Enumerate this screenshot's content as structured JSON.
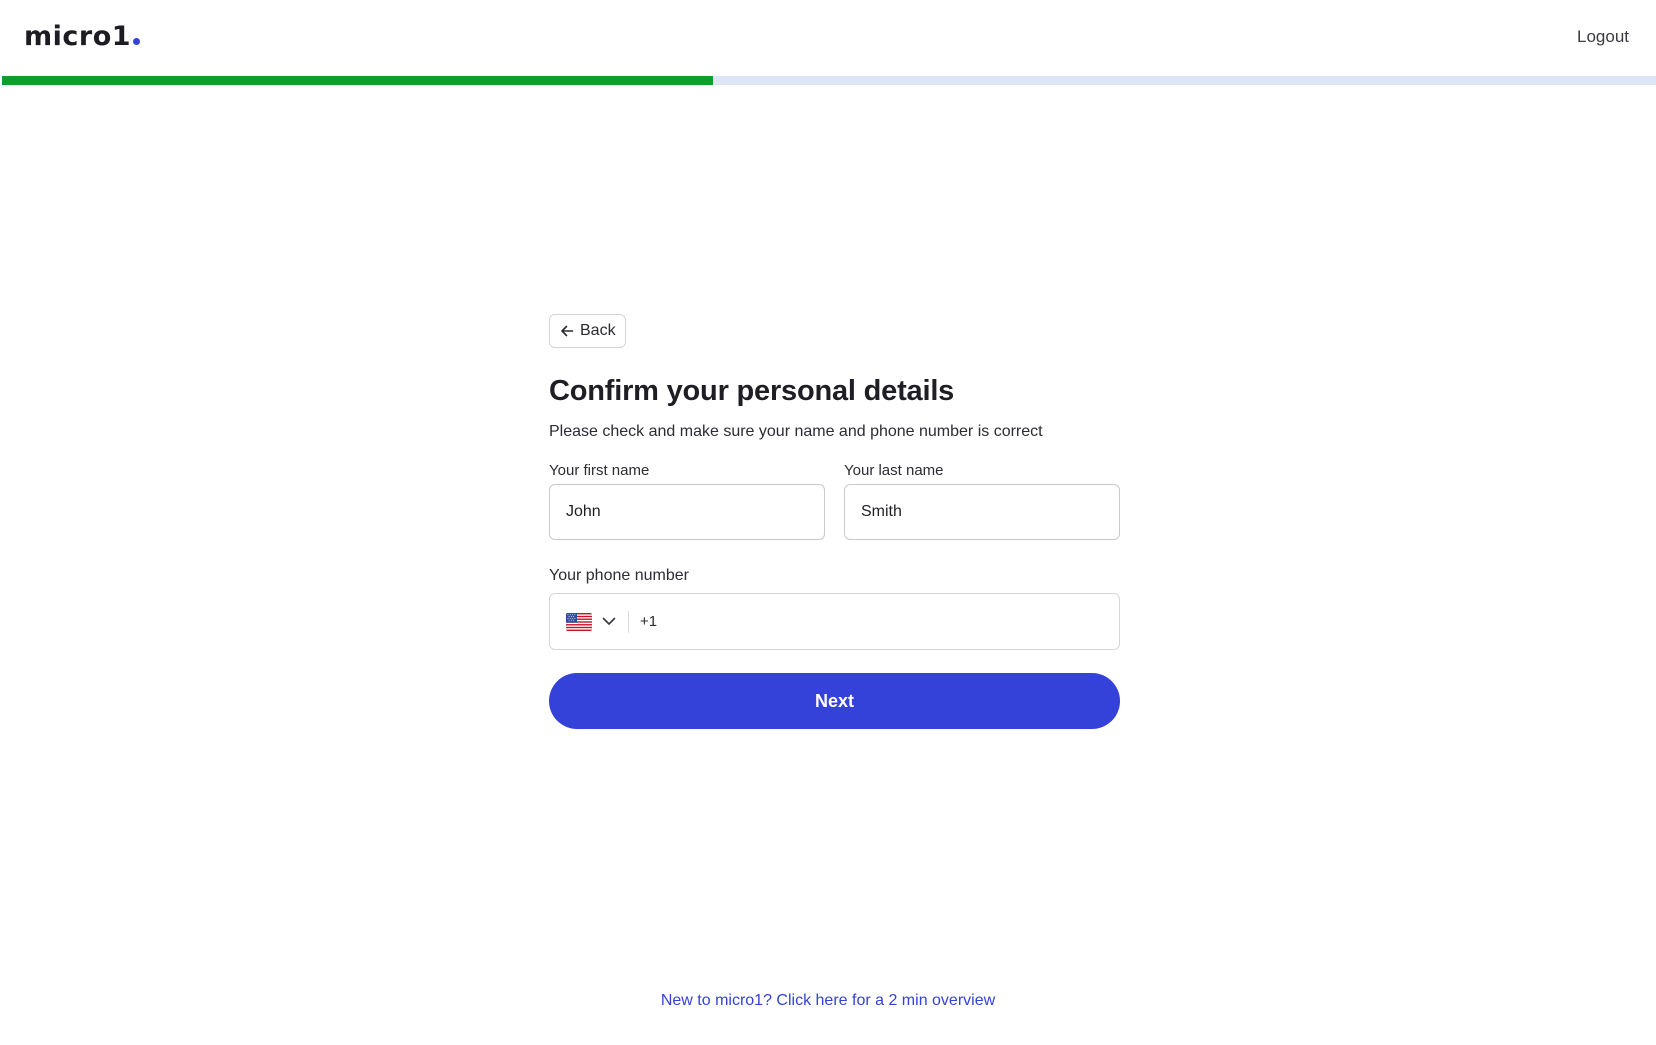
{
  "header": {
    "logo_text": "micro1",
    "logout_label": "Logout"
  },
  "progress": {
    "fraction": 0.43
  },
  "form": {
    "back_label": "Back",
    "title": "Confirm your personal details",
    "subtitle": "Please check and make sure your name and phone number is correct",
    "first_name_label": "Your first name",
    "first_name_value": "John",
    "last_name_label": "Your last name",
    "last_name_value": "Smith",
    "phone_label": "Your phone number",
    "country_flag_icon": "us-flag-icon",
    "dial_code": "+1",
    "phone_value": "",
    "next_label": "Next"
  },
  "footer": {
    "overview_link": "New to micro1? Click here for a 2 min overview"
  },
  "colors": {
    "accent": "#3442d9",
    "progress_complete": "#0c9e2f",
    "progress_track": "#dde6f7",
    "link": "#3442d9",
    "logo_dot": "#3442d9"
  }
}
